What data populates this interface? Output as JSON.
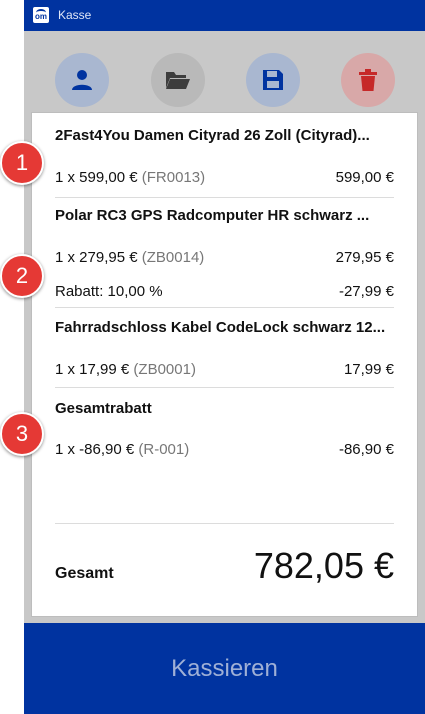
{
  "window": {
    "title": "Kasse",
    "logo_text": "om"
  },
  "toolbar": {
    "customer_icon": "user-icon",
    "open_icon": "folder-open-icon",
    "save_icon": "floppy-disk-icon",
    "delete_icon": "trash-icon"
  },
  "cart": {
    "items": [
      {
        "name": "2Fast4You Damen Cityrad 26 Zoll (Cityrad)...",
        "qty_price": "1 x 599,00 €",
        "code": "(FR0013)",
        "amount": "599,00 €"
      },
      {
        "name": "Polar RC3 GPS Radcomputer HR schwarz ...",
        "qty_price": "1 x 279,95 €",
        "code": "(ZB0014)",
        "amount": "279,95 €",
        "discount_label": "Rabatt: 10,00 %",
        "discount_amount": "-27,99 €"
      },
      {
        "name": "Fahrradschloss Kabel CodeLock schwarz 12...",
        "qty_price": "1 x 17,99 €",
        "code": "(ZB0001)",
        "amount": "17,99 €"
      },
      {
        "name": "Gesamtrabatt",
        "qty_price": "1 x -86,90 €",
        "code": "(R-001)",
        "amount": "-86,90 €"
      }
    ],
    "total_label": "Gesamt",
    "total_value": "782,05 €"
  },
  "checkout_button": "Kassieren",
  "callouts": [
    "1",
    "2",
    "3"
  ],
  "colors": {
    "primary": "#0033a0",
    "callout": "#e53935",
    "delete": "#c62828"
  }
}
